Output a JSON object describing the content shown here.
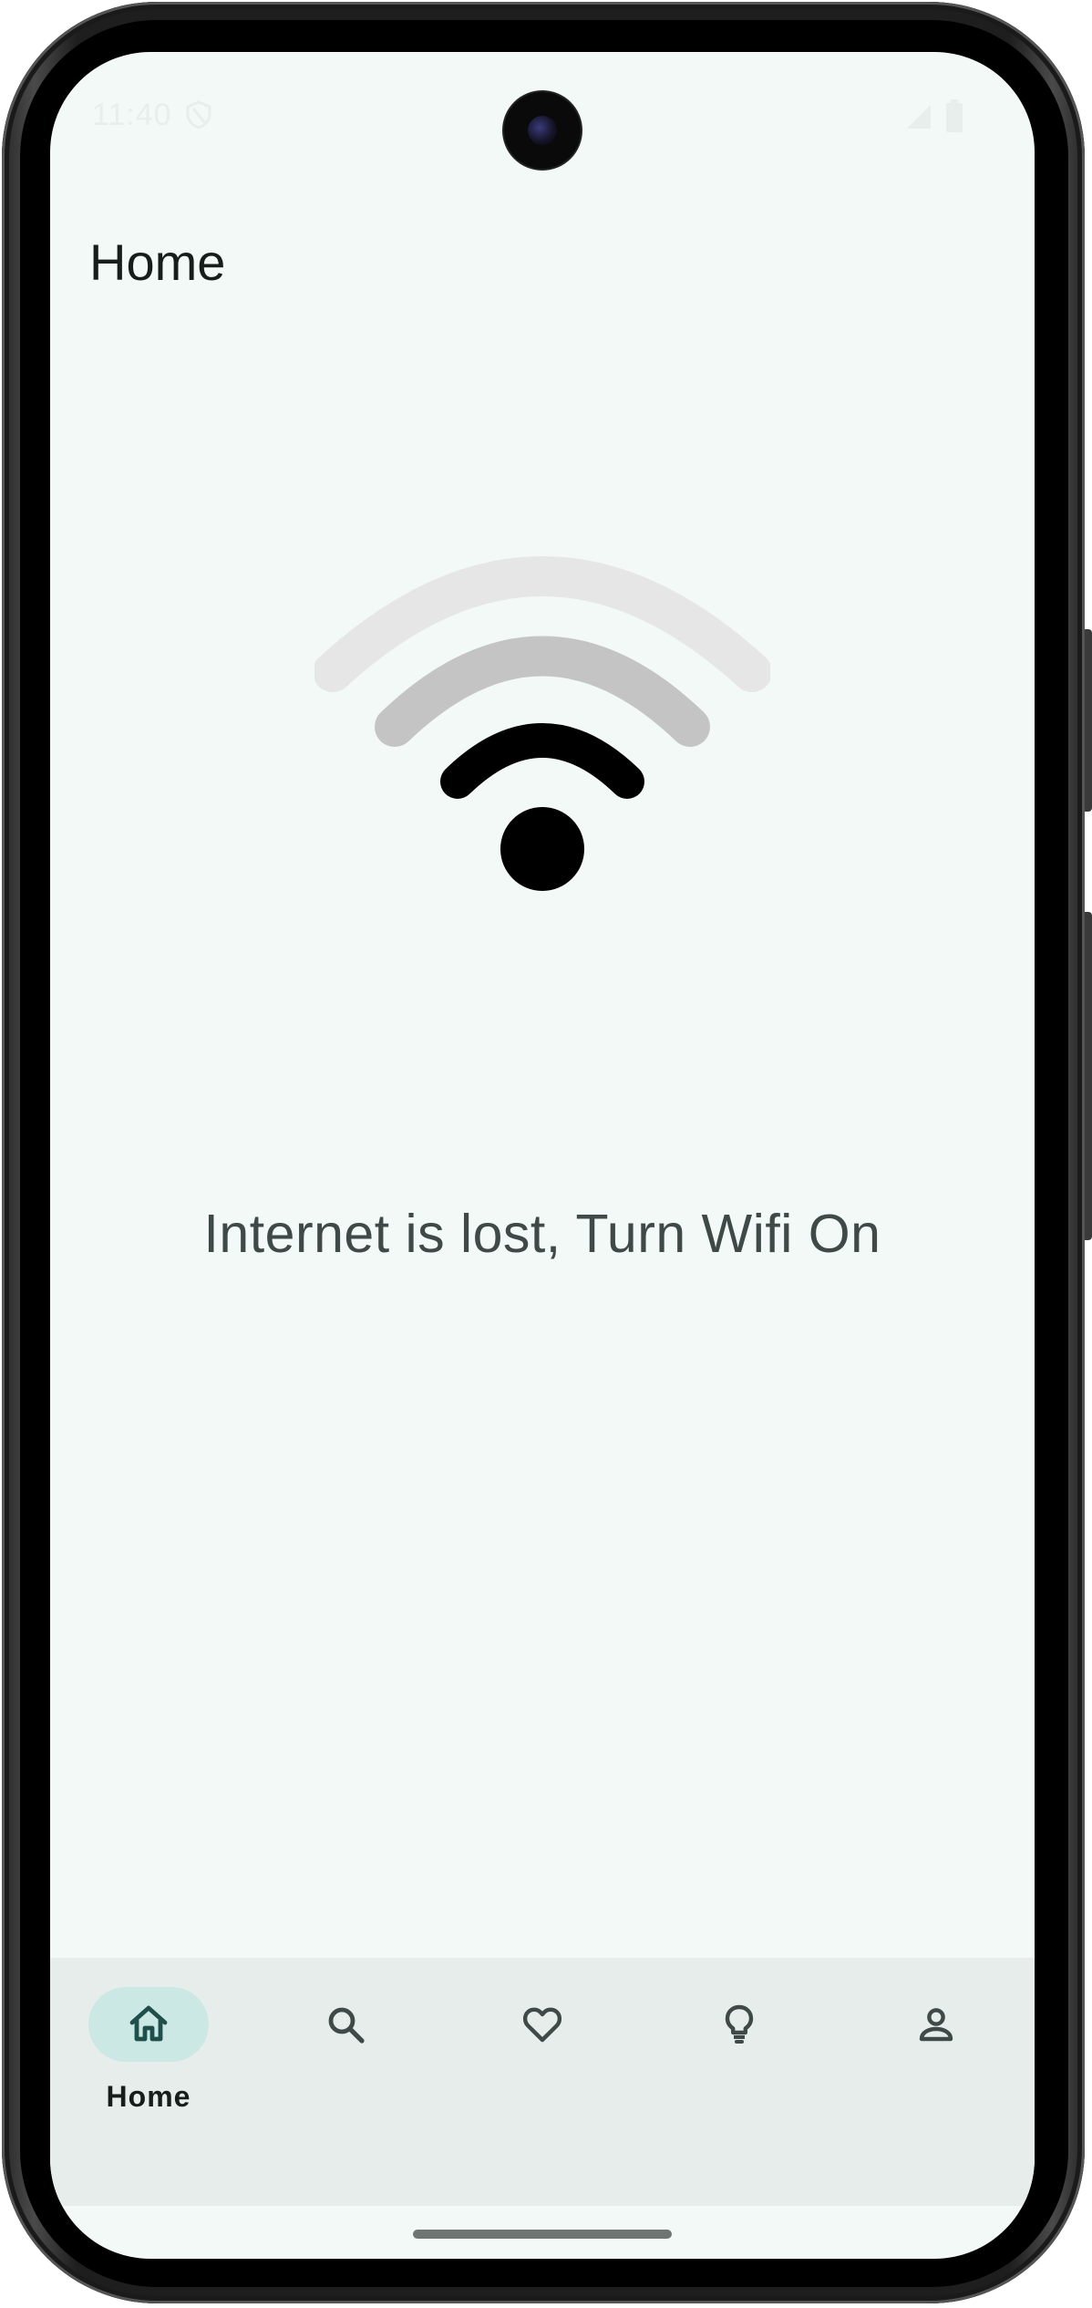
{
  "status_bar": {
    "time": "11:40",
    "icons": [
      "shield-icon",
      "cell-signal-icon",
      "battery-icon"
    ]
  },
  "header": {
    "title": "Home"
  },
  "main": {
    "illustration_icon": "wifi-icon",
    "message": "Internet is lost, Turn Wifi On"
  },
  "bottom_nav": {
    "items": [
      {
        "label": "Home",
        "icon": "home-icon",
        "selected": true
      },
      {
        "label": "",
        "icon": "search-icon",
        "selected": false
      },
      {
        "label": "",
        "icon": "heart-icon",
        "selected": false
      },
      {
        "label": "",
        "icon": "lightbulb-icon",
        "selected": false
      },
      {
        "label": "",
        "icon": "person-icon",
        "selected": false
      }
    ]
  },
  "colors": {
    "background": "#f3f9f7",
    "nav_background": "#e7edea",
    "selected_pill": "#cce8e4",
    "message_text": "#3f4948",
    "icon": "#3f4948"
  }
}
